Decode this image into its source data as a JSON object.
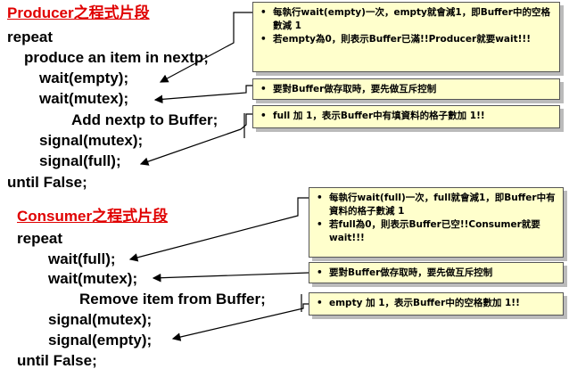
{
  "producer": {
    "title": "Producer之程式片段",
    "lines": [
      "repeat",
      "produce an item in nextp;",
      "wait(empty);",
      "wait(mutex);",
      "Add nextp to Buffer;",
      "signal(mutex);",
      "signal(full);",
      "until False;"
    ]
  },
  "consumer": {
    "title": "Consumer之程式片段",
    "lines": [
      "repeat",
      "wait(full);",
      "wait(mutex);",
      "Remove item from Buffer;",
      "signal(mutex);",
      "signal(empty);",
      "until False;"
    ]
  },
  "notes": {
    "p1": [
      "每執行wait(empty)一次，empty就會減1，即Buffer中的空格數減 1",
      "若empty為0，則表示Buffer已滿!!Producer就要wait!!!"
    ],
    "p2": [
      "要對Buffer做存取時，要先做互斥控制"
    ],
    "p3": [
      "full 加 1，表示Buffer中有填資料的格子數加 1!!"
    ],
    "c1": [
      "每執行wait(full)一次，full就會減1，即Buffer中有資料的格子數減 1",
      "若full為0，則表示Buffer已空!!Consumer就要wait!!!"
    ],
    "c2": [
      "要對Buffer做存取時，要先做互斥控制"
    ],
    "c3": [
      "empty 加 1，表示Buffer中的空格數加 1!!"
    ]
  }
}
